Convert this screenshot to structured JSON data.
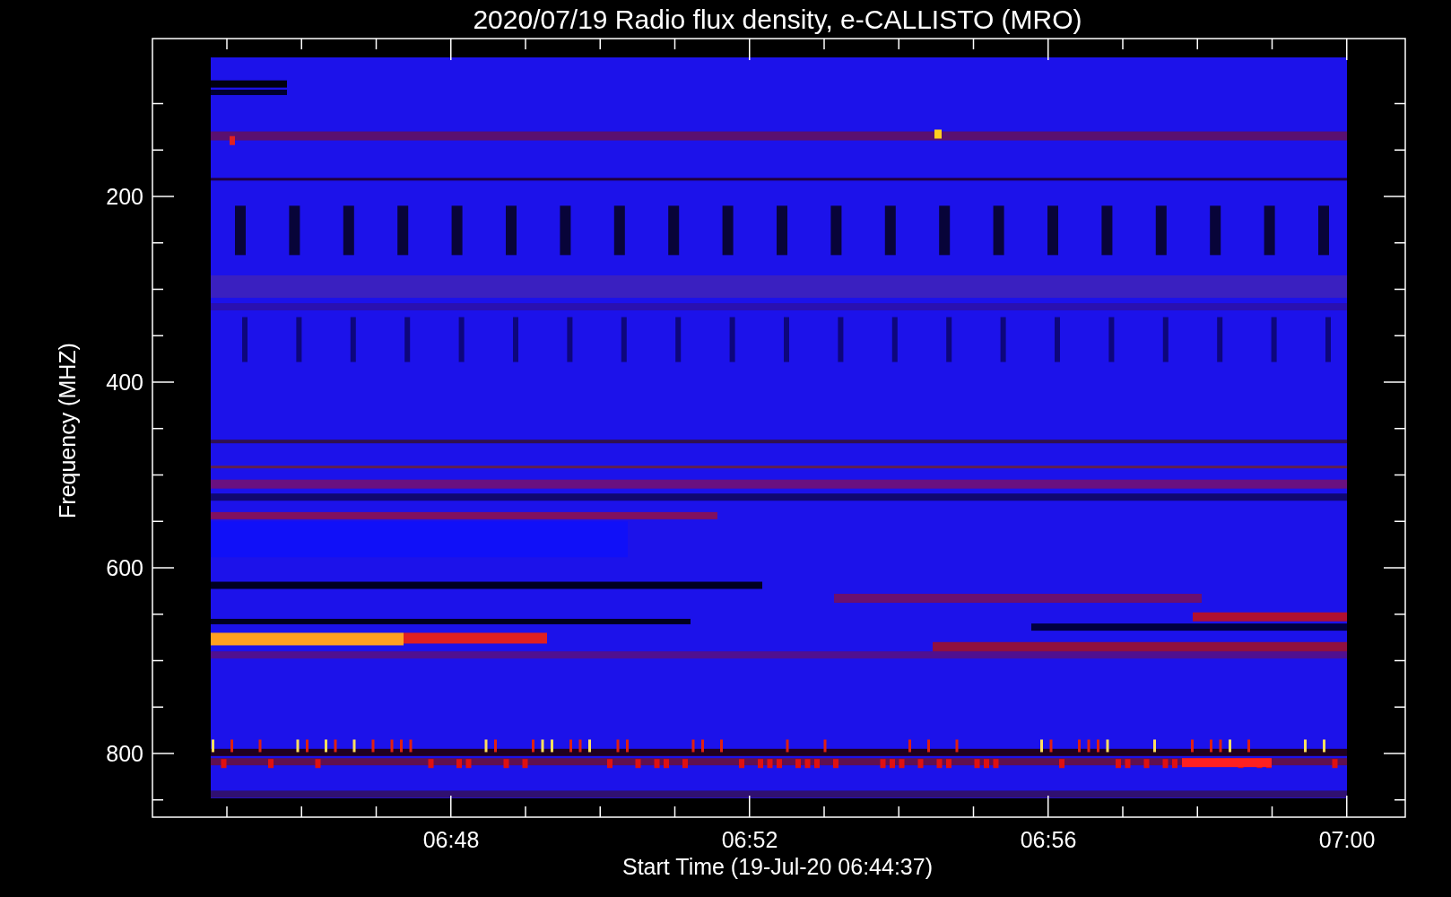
{
  "title": "2020/07/19  Radio flux density, e-CALLISTO (MRO)",
  "y_axis": {
    "label": "Frequency (MHZ)",
    "ticks": [
      "200",
      "400",
      "600",
      "800"
    ]
  },
  "x_axis": {
    "label": "Start Time (19-Jul-20 06:44:37)",
    "ticks": [
      "06:48",
      "06:52",
      "06:56",
      "07:00"
    ]
  }
}
